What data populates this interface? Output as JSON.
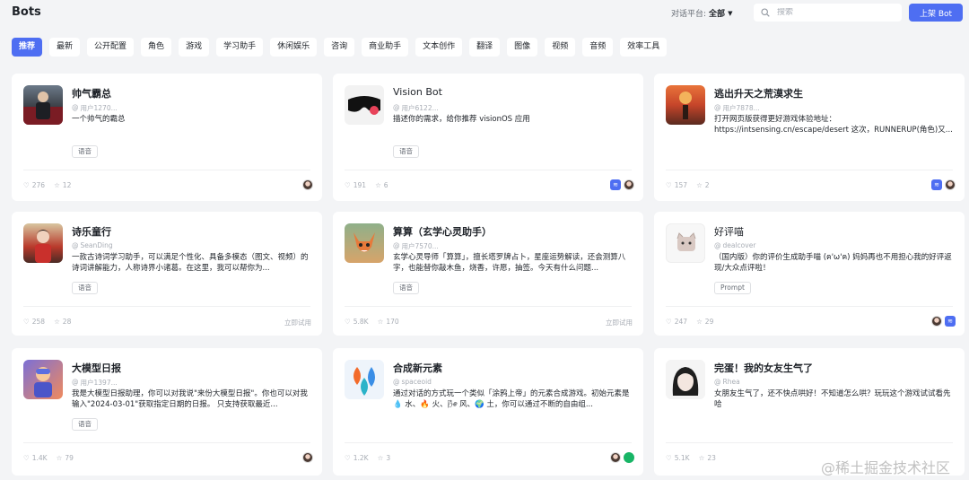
{
  "header": {
    "title": "Bots",
    "platform_label": "对话平台:",
    "platform_value": "全部",
    "search_placeholder": "搜索",
    "publish_button": "上架 Bot"
  },
  "tabs": [
    "推荐",
    "最新",
    "公开配置",
    "角色",
    "游戏",
    "学习助手",
    "休闲娱乐",
    "咨询",
    "商业助手",
    "文本创作",
    "翻译",
    "图像",
    "视频",
    "音频",
    "效率工具"
  ],
  "cards": [
    {
      "name": "帅气霸总",
      "author": "用户1270...",
      "desc": "一个帅气的霸总",
      "tag": "语音",
      "likes": "276",
      "stars": "12",
      "try": ""
    },
    {
      "name": "Vision Bot",
      "author": "用户6122...",
      "desc": "描述你的需求，给你推荐 visionOS 应用",
      "tag": "语音",
      "likes": "191",
      "stars": "6",
      "try": ""
    },
    {
      "name": "逃出升天之荒漠求生",
      "author": "用户7878...",
      "desc": "打开网页版获得更好游戏体验地址：https://intsensing.cn/escape/desert 这次，RUNNERUP(角色)又...",
      "tag": "",
      "likes": "157",
      "stars": "2",
      "try": ""
    },
    {
      "name": "诗乐童行",
      "author": "SeanDing",
      "desc": "一款古诗词学习助手，可以满足个性化、具备多模态（图文、视频）的诗词讲解能力，人称诗界小诸葛。在这里，我可以帮你为...",
      "tag": "语音",
      "likes": "258",
      "stars": "28",
      "try": "立即试用"
    },
    {
      "name": "算算（玄学心灵助手）",
      "author": "用户7570...",
      "desc": "玄学心灵导师「算算」，擅长塔罗牌占卜，星座运势解读，还会测算八字，也能替你敲木鱼，烧香，许愿，抽签。今天有什么问题...",
      "tag": "语音",
      "likes": "5.8K",
      "stars": "170",
      "try": "立即试用"
    },
    {
      "name": "好评喵",
      "author": "dealcover",
      "desc": "（国内版）你的评价生成助手喵 (ฅ'ω'ฅ) 妈妈再也不用担心我的好评返现/大众点评啦！",
      "tag": "Prompt",
      "likes": "247",
      "stars": "29",
      "try": ""
    },
    {
      "name": "大模型日报",
      "author": "用户1397...",
      "desc": "我是大模型日报助理，你可以对我说\"来份大模型日报\"。你也可以对我输入\"2024-03-01\"获取指定日期的日报。 只支持获取最近...",
      "tag": "语音",
      "likes": "1.4K",
      "stars": "79",
      "try": ""
    },
    {
      "name": "合成新元素",
      "author": "spaceoid",
      "desc": "通过对话的方式玩一个类似「涂鸦上帝」的元素合成游戏。初始元素是 💧 水、🔥 火、🌬 风、🌍 土，你可以通过不断的自由组...",
      "tag": "",
      "likes": "1.2K",
      "stars": "3",
      "try": ""
    },
    {
      "name": "完蛋！我的女友生气了",
      "author": "Rhea",
      "desc": "女朋友生气了，还不快点哄好！不知道怎么哄？玩玩这个游戏试试看先哈",
      "tag": "",
      "likes": "5.1K",
      "stars": "23",
      "try": ""
    }
  ],
  "watermark": "@稀土掘金技术社区",
  "colors": {
    "accent": "#4e6ef2",
    "background": "#f3f4f6",
    "card": "#ffffff"
  }
}
